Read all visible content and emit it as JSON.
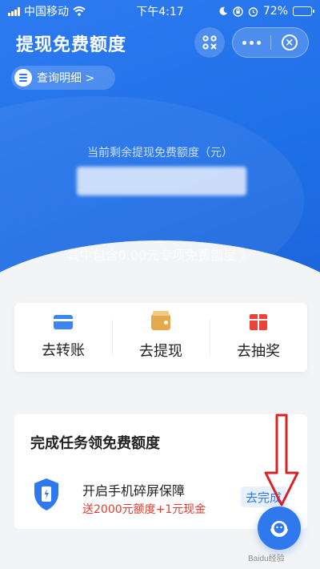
{
  "status_bar": {
    "carrier": "中国移动",
    "time": "下午4:17",
    "battery": "72%",
    "battery_level": 0.72
  },
  "header": {
    "title": "提现免费额度",
    "detail_link": "查询明细 >"
  },
  "balance": {
    "label": "当前剩余提现免费额度（元）",
    "special_quota": "其中包含0.00元专项免费额度 》"
  },
  "actions": [
    {
      "label": "去转账",
      "icon": "bank-card-icon",
      "color": "#3d84f0"
    },
    {
      "label": "去提现",
      "icon": "wallet-icon",
      "color": "#e4a94c"
    },
    {
      "label": "去抽奖",
      "icon": "gift-icon",
      "color": "#e9433b"
    }
  ],
  "tasks": {
    "title": "完成任务领免费额度",
    "items": [
      {
        "name": "开启手机碎屏保障",
        "reward": "送2000元额度+1元现金",
        "button": "去完成",
        "icon": "shield-phone-icon"
      }
    ]
  },
  "watermark": "Baidu经验",
  "colors": {
    "brand_blue": "#2f78ee",
    "reward_red": "#e33c2e",
    "annotation_red": "#d6232a"
  }
}
